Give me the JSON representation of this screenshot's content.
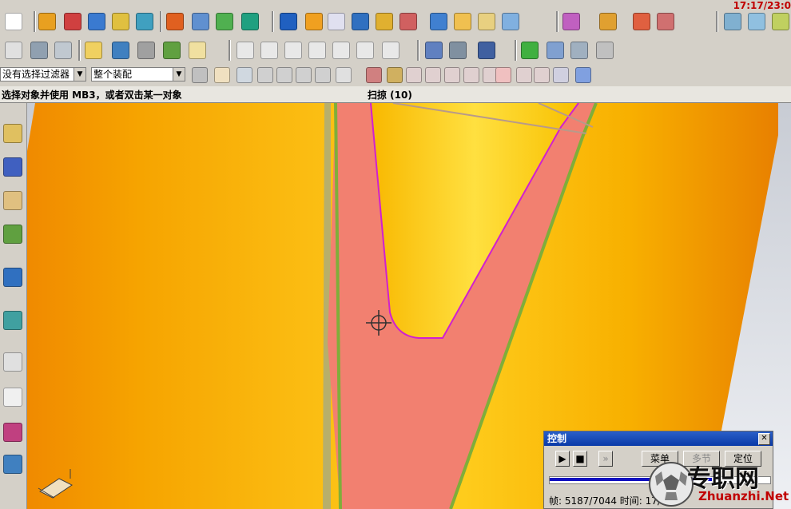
{
  "header": {
    "clock": "17:17/23:0"
  },
  "selection_bar": {
    "filter_value": "没有选择过滤器",
    "scope_value": "整个装配"
  },
  "status": {
    "prompt": "选择对象并使用 MB3，或者双击某一对象",
    "title": "扫掠 (10)"
  },
  "control_panel": {
    "title": "控制",
    "close_label": "✕",
    "menu_label": "菜单",
    "section_label": "多节",
    "locate_label": "定位",
    "progress": 0.736,
    "frame_text": "帧: 5187/7044 时间:",
    "time_text": "17/25:"
  },
  "watermark": {
    "title": "专职网",
    "url": "Zhuanzhi.Net"
  },
  "colors": {
    "body_orange": "#f6a400",
    "sweep_red": "#f28070",
    "profile_magenta": "#d020d0",
    "edge_green": "#7fae3a",
    "progress_blue": "#1010c0"
  }
}
